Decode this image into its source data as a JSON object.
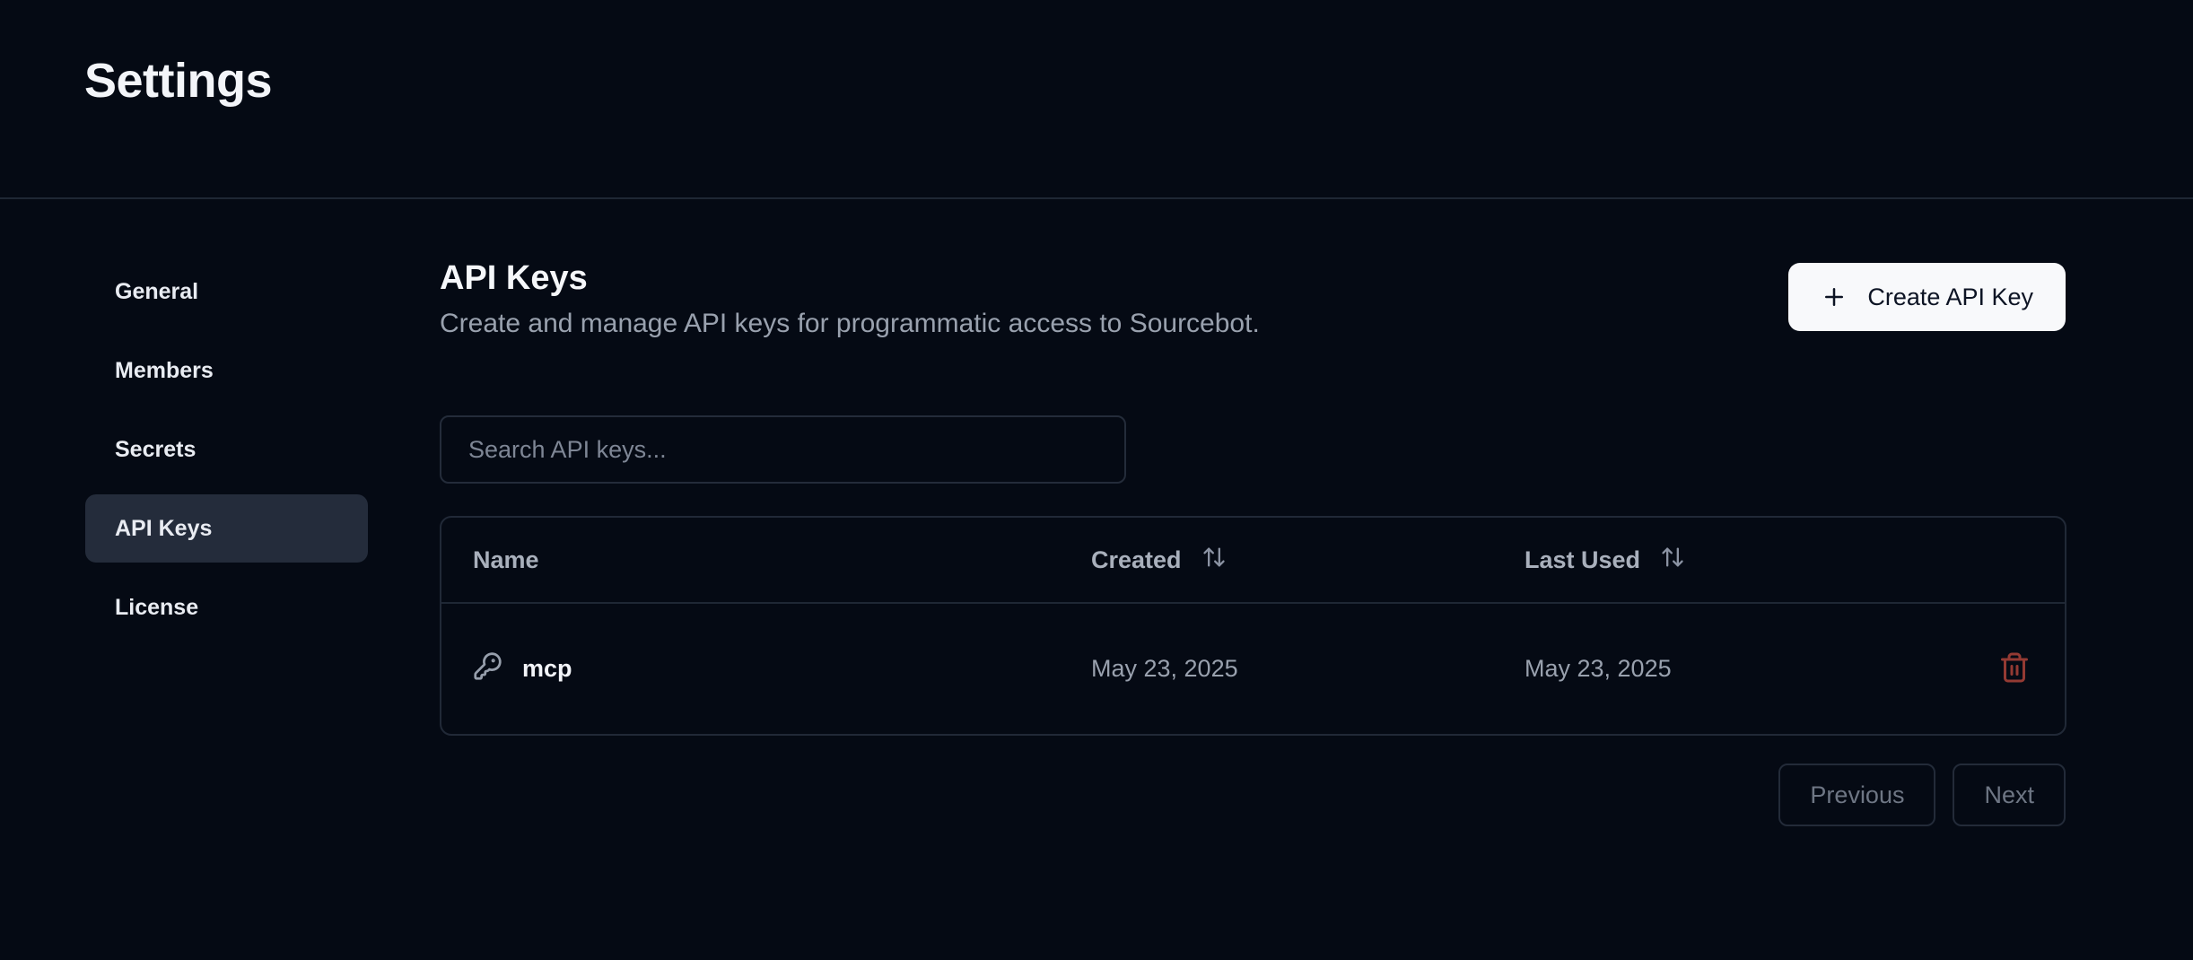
{
  "page": {
    "title": "Settings"
  },
  "sidebar": {
    "items": [
      {
        "label": "General",
        "active": false
      },
      {
        "label": "Members",
        "active": false
      },
      {
        "label": "Secrets",
        "active": false
      },
      {
        "label": "API Keys",
        "active": true
      },
      {
        "label": "License",
        "active": false
      }
    ]
  },
  "main": {
    "heading": "API Keys",
    "subheading": "Create and manage API keys for programmatic access to Sourcebot.",
    "create_button": {
      "label": "Create API Key",
      "icon": "plus-icon"
    },
    "search": {
      "placeholder": "Search API keys..."
    },
    "table": {
      "columns": [
        {
          "label": "Name",
          "sortable": false
        },
        {
          "label": "Created",
          "sortable": true,
          "icon": "sort-arrows-icon"
        },
        {
          "label": "Last Used",
          "sortable": true,
          "icon": "sort-arrows-icon"
        }
      ],
      "rows": [
        {
          "icon": "key-icon",
          "name": "mcp",
          "created": "May 23, 2025",
          "last_used": "May 23, 2025",
          "action_icon": "trash-icon"
        }
      ]
    },
    "pagination": {
      "previous_label": "Previous",
      "next_label": "Next"
    }
  },
  "colors": {
    "background": "#050a14",
    "active_item_bg": "#242c3b",
    "border": "#212937",
    "primary_button_bg": "#f8f9fb",
    "primary_button_text": "#0d1424",
    "muted_text": "#99a1ae",
    "destructive": "#943a33"
  }
}
